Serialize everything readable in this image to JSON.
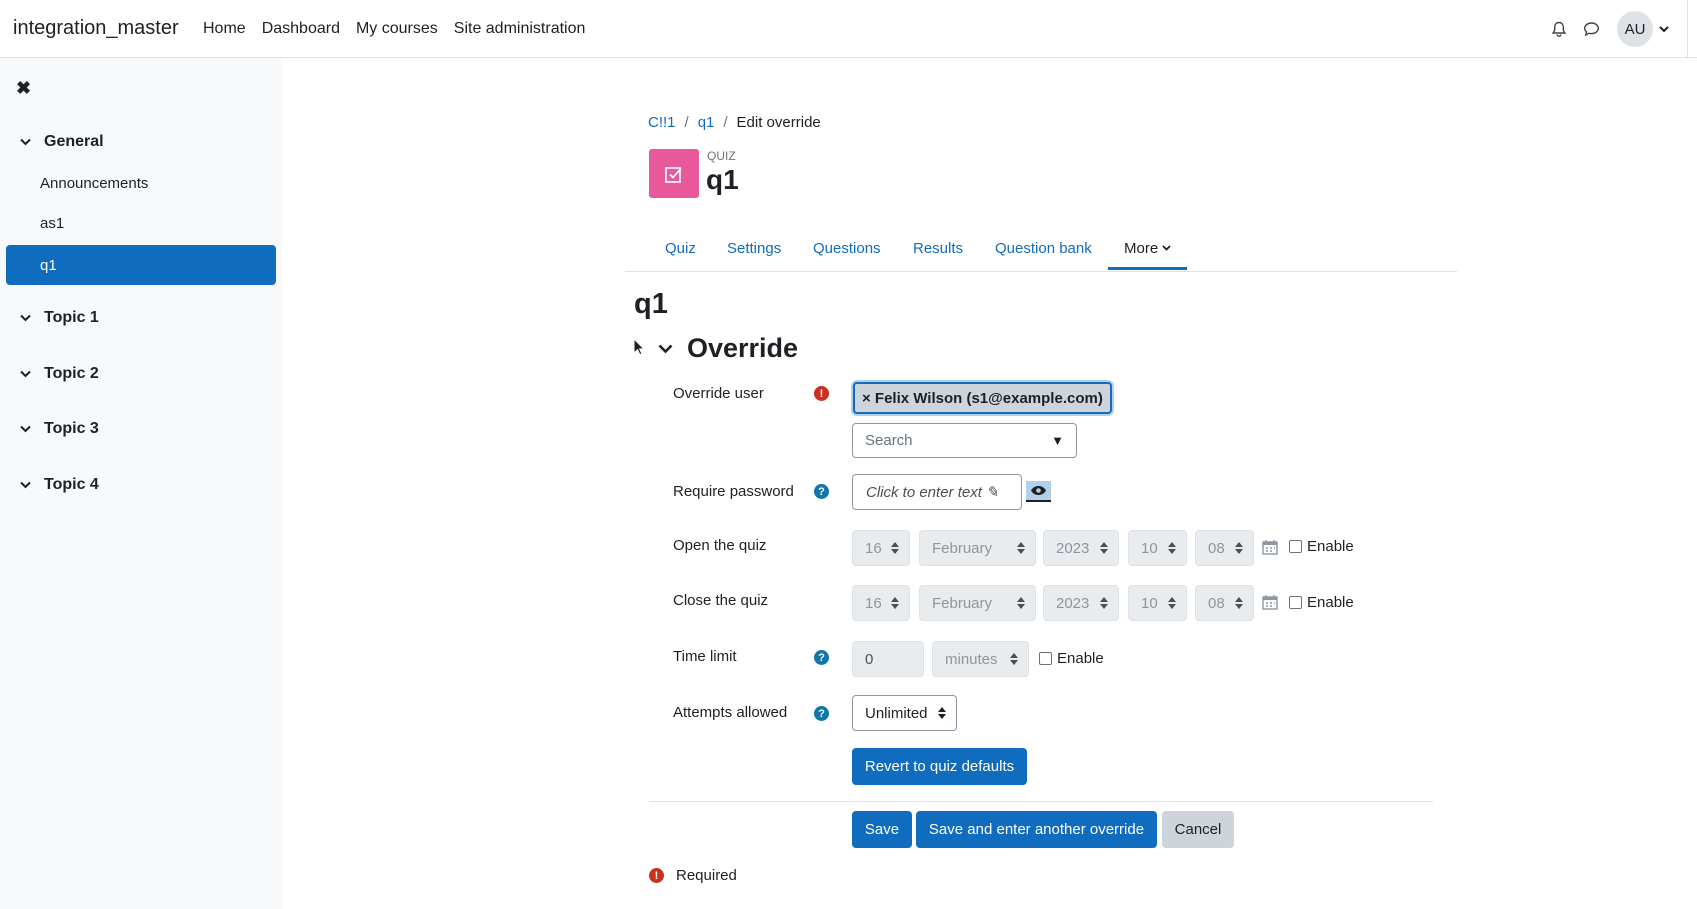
{
  "site": {
    "brand": "integration_master"
  },
  "primary_nav": [
    "Home",
    "Dashboard",
    "My courses",
    "Site administration"
  ],
  "user": {
    "initials": "AU"
  },
  "icons": {
    "notifications": "bell-icon",
    "messages": "chat-bubble-icon",
    "drawer_close": "close-icon"
  },
  "drawer": {
    "close_glyph": "✖",
    "sections": [
      {
        "title": "General",
        "items": [
          "Announcements",
          "as1",
          "q1"
        ],
        "active": "q1"
      },
      {
        "title": "Topic 1"
      },
      {
        "title": "Topic 2"
      },
      {
        "title": "Topic 3"
      },
      {
        "title": "Topic 4"
      }
    ]
  },
  "breadcrumb": {
    "course": "C!!1",
    "quiz": "q1",
    "current": "Edit override",
    "sep": "/"
  },
  "header": {
    "kicker": "QUIZ",
    "title": "q1"
  },
  "tabs": [
    "Quiz",
    "Settings",
    "Questions",
    "Results",
    "Question bank",
    "More"
  ],
  "page_heading": "q1",
  "section_title": "Override",
  "form": {
    "override_user": {
      "label": "Override user",
      "selected": "× Felix Wilson (s1@example.com)",
      "search_placeholder": "Search",
      "search_arrow": "▼"
    },
    "require_password": {
      "label": "Require password",
      "placeholder": "Click to enter text ✎"
    },
    "open_quiz": {
      "label": "Open the quiz",
      "day": "16",
      "month": "February",
      "year": "2023",
      "hour": "10",
      "minute": "08",
      "enable": "Enable"
    },
    "close_quiz": {
      "label": "Close the quiz",
      "day": "16",
      "month": "February",
      "year": "2023",
      "hour": "10",
      "minute": "08",
      "enable": "Enable"
    },
    "time_limit": {
      "label": "Time limit",
      "value": "0",
      "unit": "minutes",
      "enable": "Enable"
    },
    "attempts": {
      "label": "Attempts allowed",
      "value": "Unlimited"
    },
    "revert_label": "Revert to quiz defaults"
  },
  "actions": {
    "save": "Save",
    "save_another": "Save and enter another override",
    "cancel": "Cancel"
  },
  "required_note": "Required",
  "colors": {
    "primary": "#0f6cbf",
    "quiz_icon": "#e9589a",
    "required": "#ca3120",
    "help": "#1177a7"
  }
}
